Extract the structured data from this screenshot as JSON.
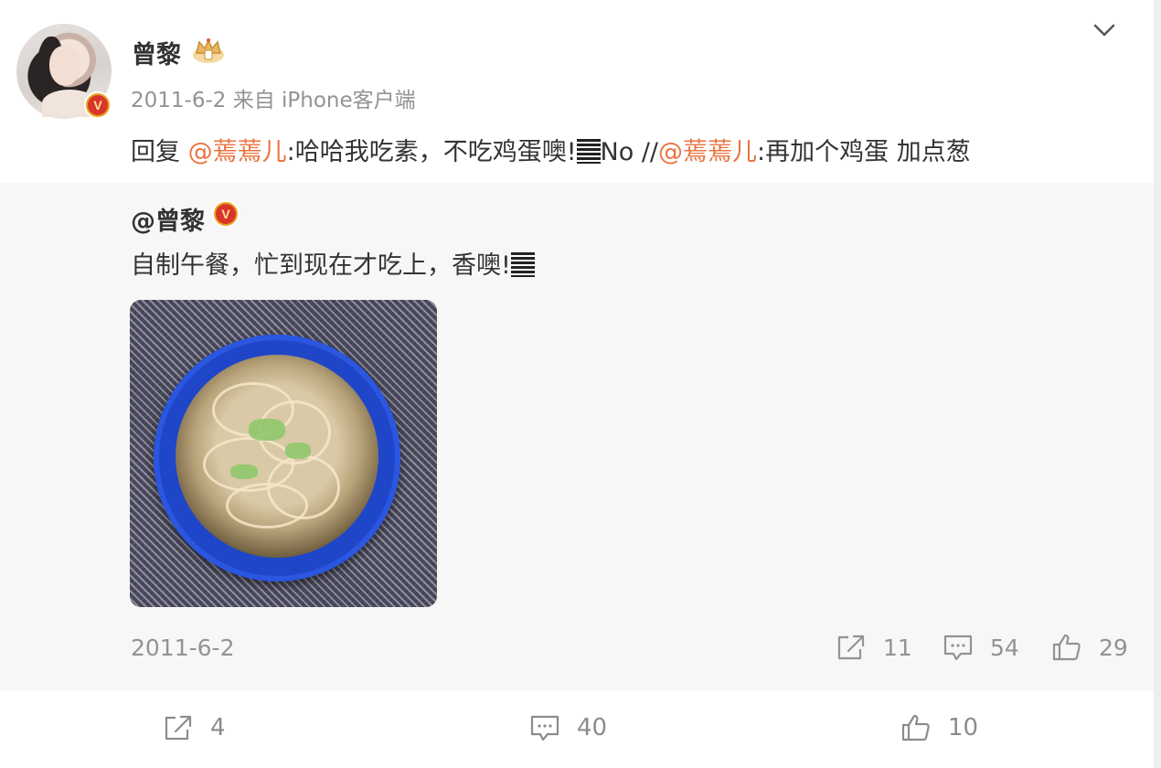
{
  "post": {
    "author": "曾黎",
    "meta": "2011-6-2 来自 iPhone客户端",
    "reply": {
      "prefix": "回复 ",
      "mention1": "@蔫蔫儿",
      "text1": ":哈哈我吃素，不吃鸡蛋噢!",
      "text2": "No //",
      "mention2": "@蔫蔫儿",
      "text3": ":再加个鸡蛋 加点葱"
    }
  },
  "repost": {
    "author": "@曾黎",
    "text": "自制午餐，忙到现在才吃上，香噢!",
    "date": "2011-6-2",
    "actions": {
      "share_count": "11",
      "comment_count": "54",
      "like_count": "29"
    }
  },
  "bottom_bar": {
    "share_count": "4",
    "comment_count": "40",
    "like_count": "10"
  },
  "badge": {
    "letter": "V"
  },
  "colors": {
    "mention": "#eb7340",
    "muted": "#939393",
    "card_bg": "#f7f7f7"
  },
  "icons": [
    "chevron-down-icon",
    "crown-icon",
    "verified-badge-icon",
    "share-icon",
    "comment-icon",
    "like-icon"
  ]
}
